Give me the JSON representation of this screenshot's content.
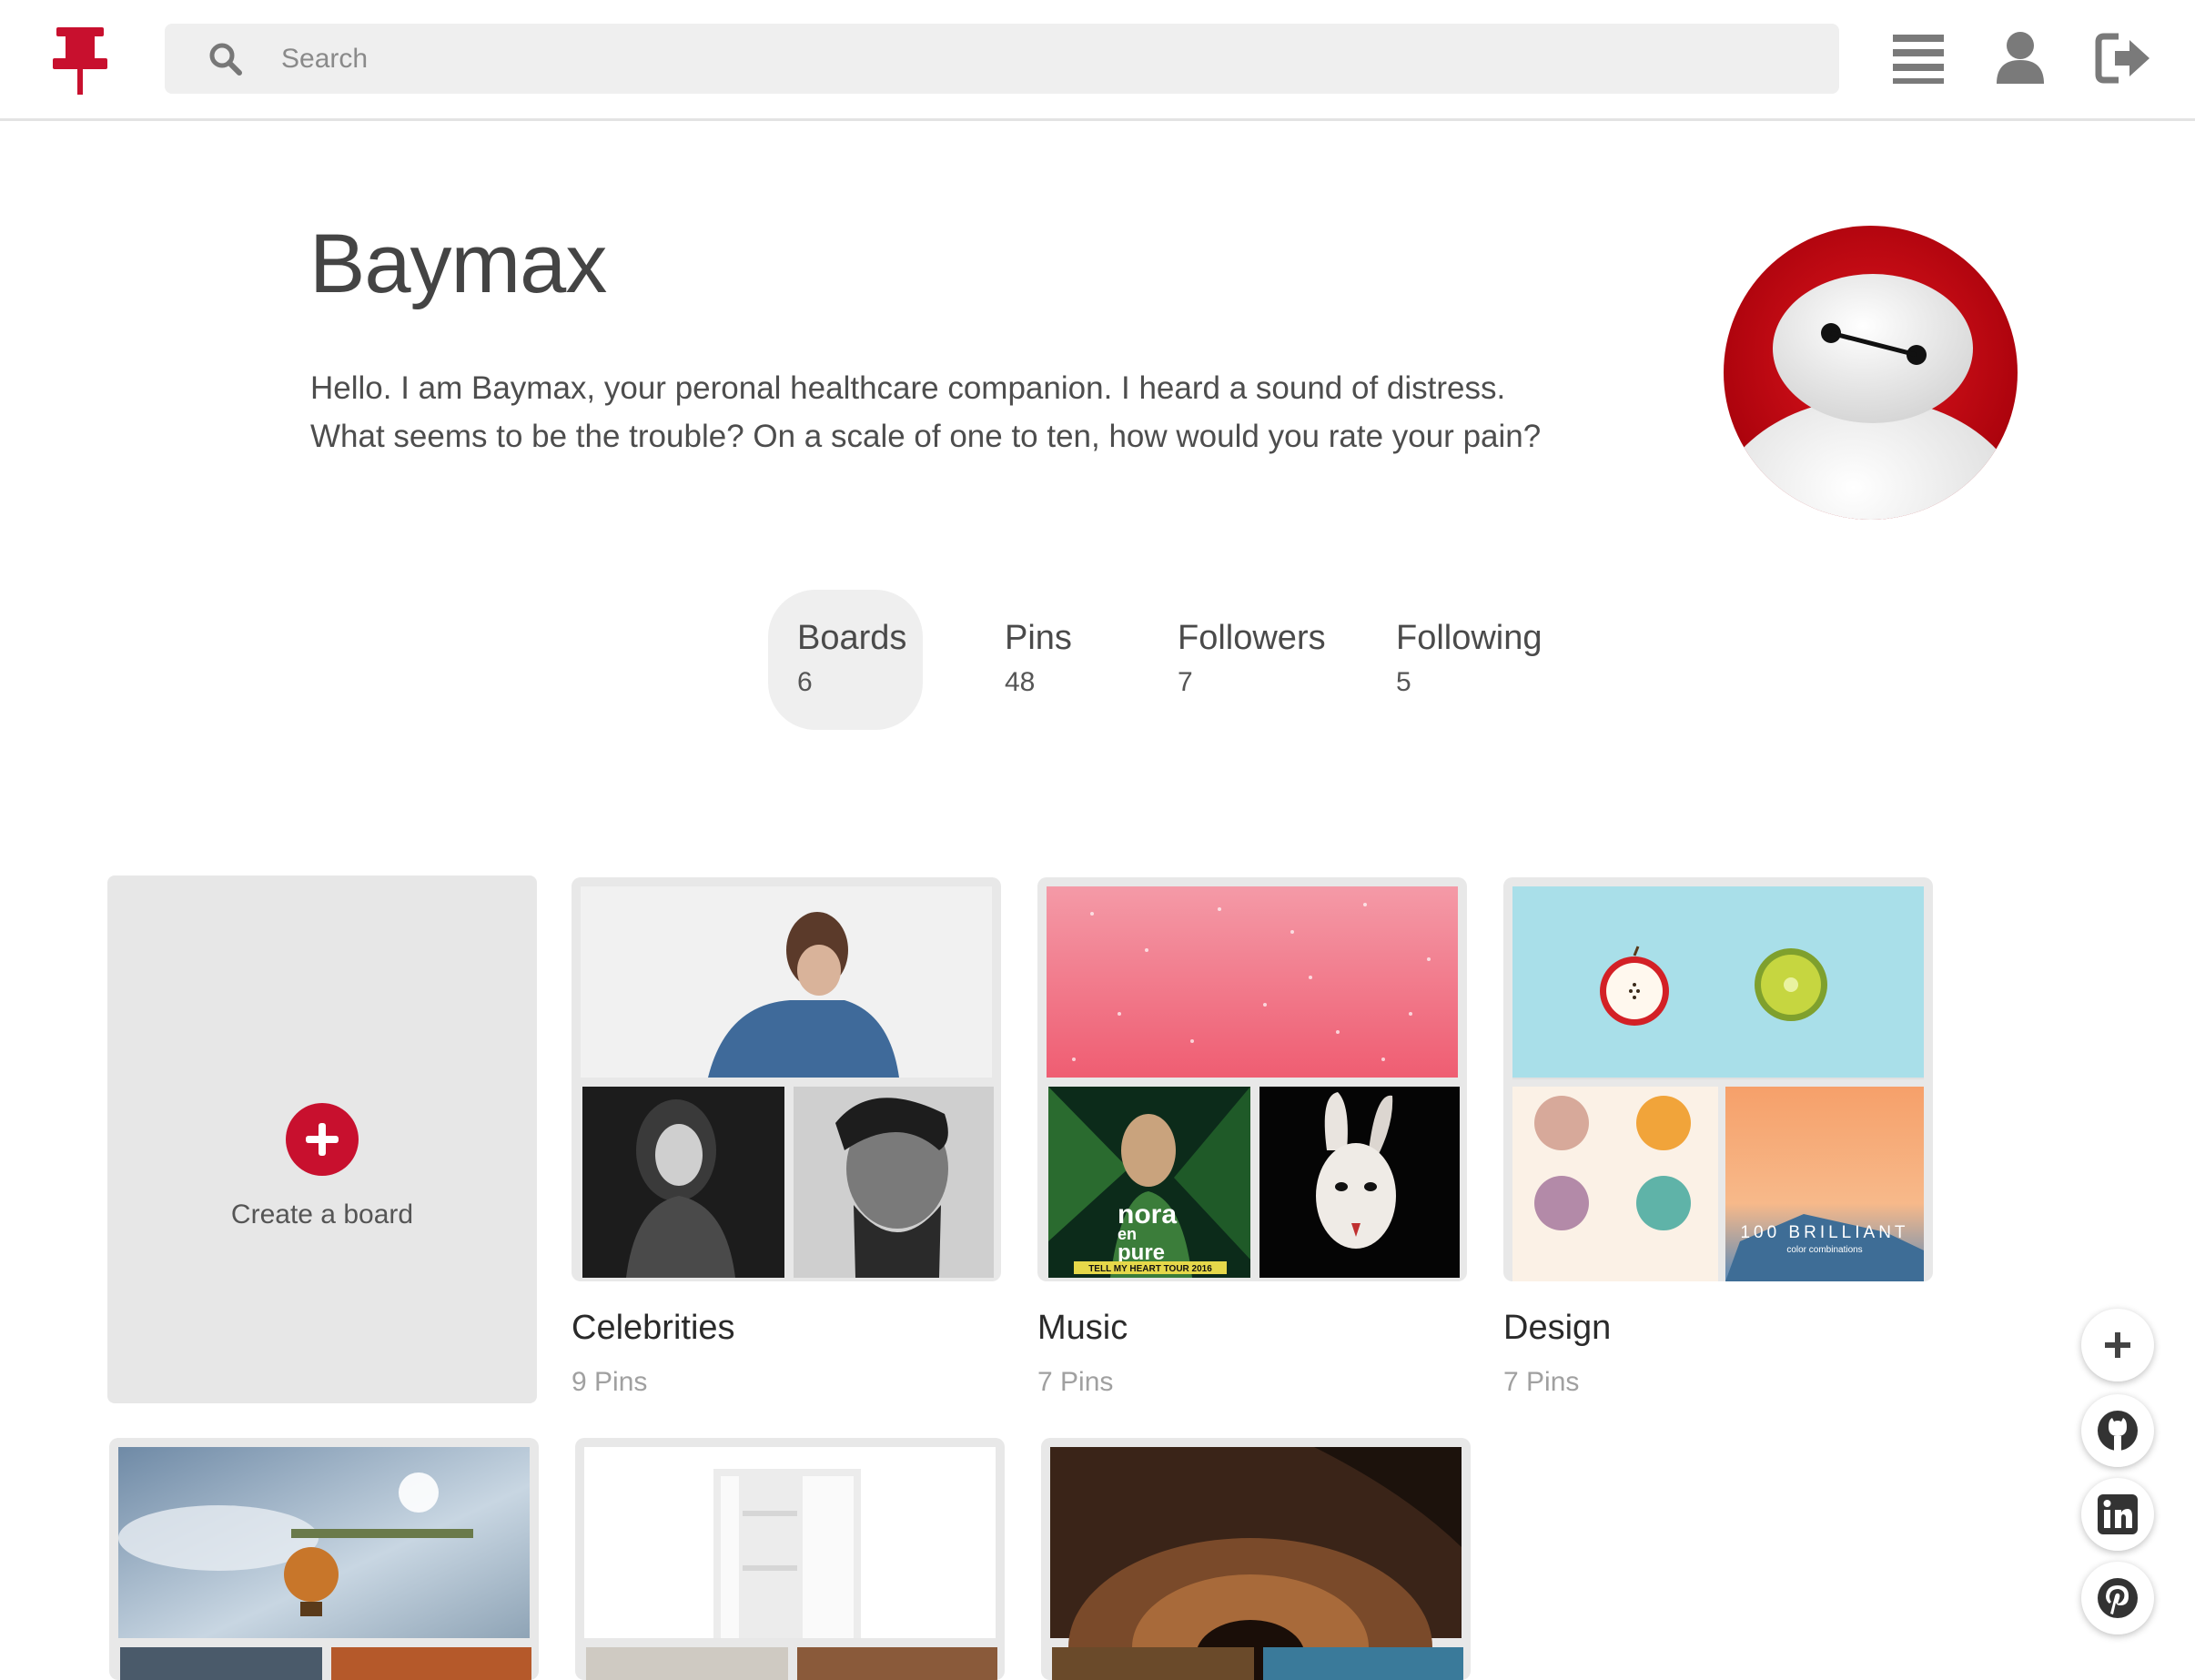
{
  "search": {
    "placeholder": "Search"
  },
  "header_icons": [
    "menu-icon",
    "user-icon",
    "logout-icon"
  ],
  "profile": {
    "name": "Baymax",
    "bio": "Hello. I am Baymax, your peronal healthcare companion. I heard a sound of distress. What seems to be the trouble? On a scale of one to ten, how would you rate your pain?"
  },
  "stats": [
    {
      "label": "Boards",
      "count": "6",
      "active": true
    },
    {
      "label": "Pins",
      "count": "48",
      "active": false
    },
    {
      "label": "Followers",
      "count": "7",
      "active": false
    },
    {
      "label": "Following",
      "count": "5",
      "active": false
    }
  ],
  "create_board": {
    "label": "Create a board"
  },
  "boards": [
    {
      "title": "Celebrities",
      "pins": "9 Pins"
    },
    {
      "title": "Music",
      "pins": "7 Pins"
    },
    {
      "title": "Design",
      "pins": "7 Pins"
    },
    {
      "title": "",
      "pins": ""
    },
    {
      "title": "",
      "pins": ""
    },
    {
      "title": "",
      "pins": ""
    }
  ],
  "music_poster_text": [
    "nora",
    "en",
    "pure",
    "TELL MY HEART TOUR 2016"
  ],
  "design_poster_text": [
    "100 BRILLIANT",
    "color combinations"
  ],
  "colors": {
    "brand": "#c8102e",
    "tab_active_bg": "#efefef"
  },
  "fab_icons": [
    "plus-icon",
    "github-icon",
    "linkedin-icon",
    "pinterest-icon"
  ]
}
